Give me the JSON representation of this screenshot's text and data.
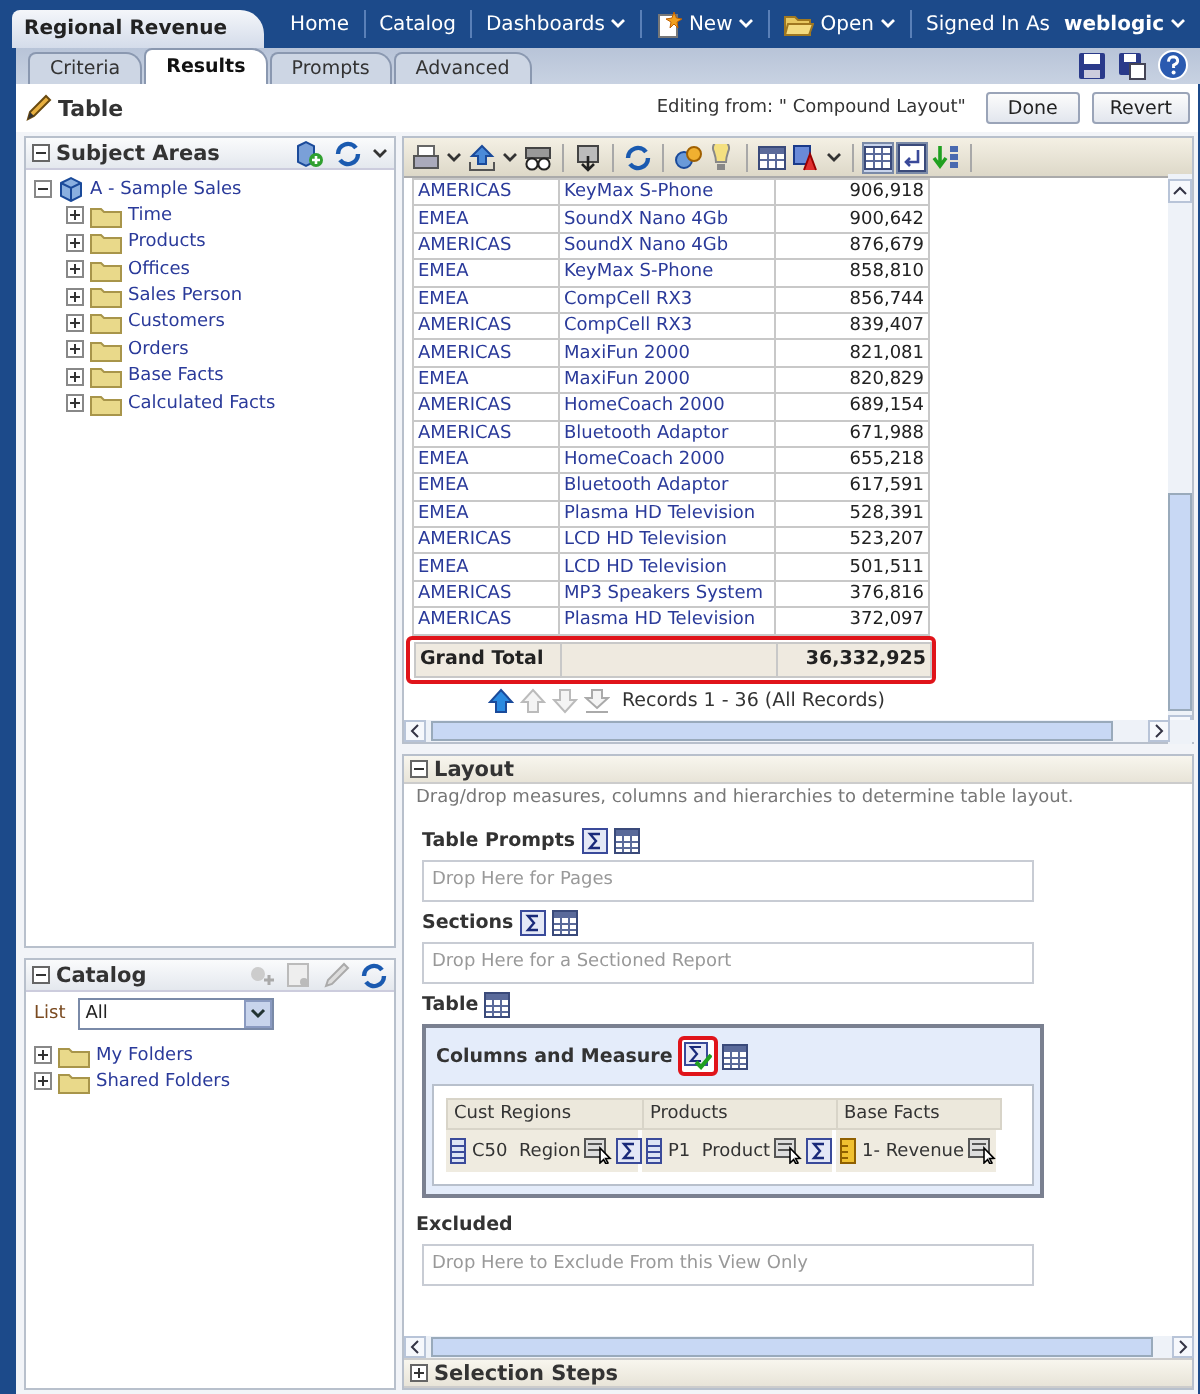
{
  "window": {
    "title": "Regional Revenue"
  },
  "nav": [
    {
      "label": "Home",
      "kind": "plain",
      "dropdown": false
    },
    {
      "label": "Catalog",
      "kind": "plain",
      "dropdown": false
    },
    {
      "label": "Dashboards",
      "kind": "plain",
      "dropdown": true
    },
    {
      "label": "New",
      "kind": "new",
      "dropdown": true
    },
    {
      "label": "Open",
      "kind": "open",
      "dropdown": true
    }
  ],
  "user": {
    "label": "Signed In As",
    "name": "weblogic",
    "dropdown": true
  },
  "tabs": [
    {
      "label": "Criteria",
      "selected": false
    },
    {
      "label": "Results",
      "selected": true
    },
    {
      "label": "Prompts",
      "selected": false
    },
    {
      "label": "Advanced",
      "selected": false
    }
  ],
  "editor": {
    "title": "Table",
    "editing": "Editing from: \" Compound Layout\"",
    "buttons": [
      "Done",
      "Revert"
    ]
  },
  "subject_areas": {
    "title": "Subject Areas",
    "root": {
      "label": "A - Sample Sales",
      "expanded": true,
      "children": [
        {
          "label": "Time",
          "expanded": false
        },
        {
          "label": "Products",
          "expanded": false
        },
        {
          "label": "Offices",
          "expanded": false
        },
        {
          "label": "Sales Person",
          "expanded": false
        },
        {
          "label": "Customers",
          "expanded": false
        },
        {
          "label": "Orders",
          "expanded": false
        },
        {
          "label": "Base Facts",
          "expanded": false
        },
        {
          "label": "Calculated Facts",
          "expanded": false
        }
      ]
    }
  },
  "catalog": {
    "title": "Catalog",
    "list_label": "List",
    "list_value": "All",
    "folders": [
      {
        "label": "My Folders",
        "expanded": false
      },
      {
        "label": "Shared Folders",
        "expanded": false
      }
    ]
  },
  "results": {
    "rows": [
      [
        "AMERICAS",
        "KeyMax S-Phone",
        "906,918"
      ],
      [
        "EMEA",
        "SoundX Nano 4Gb",
        "900,642"
      ],
      [
        "AMERICAS",
        "SoundX Nano 4Gb",
        "876,679"
      ],
      [
        "EMEA",
        "KeyMax S-Phone",
        "858,810"
      ],
      [
        "EMEA",
        "CompCell RX3",
        "856,744"
      ],
      [
        "AMERICAS",
        "CompCell RX3",
        "839,407"
      ],
      [
        "AMERICAS",
        "MaxiFun 2000",
        "821,081"
      ],
      [
        "EMEA",
        "MaxiFun 2000",
        "820,829"
      ],
      [
        "AMERICAS",
        "HomeCoach 2000",
        "689,154"
      ],
      [
        "AMERICAS",
        "Bluetooth Adaptor",
        "671,988"
      ],
      [
        "EMEA",
        "HomeCoach 2000",
        "655,218"
      ],
      [
        "EMEA",
        "Bluetooth Adaptor",
        "617,591"
      ],
      [
        "EMEA",
        "Plasma HD Television",
        "528,391"
      ],
      [
        "AMERICAS",
        "LCD HD Television",
        "523,207"
      ],
      [
        "EMEA",
        "LCD HD Television",
        "501,511"
      ],
      [
        "AMERICAS",
        "MP3 Speakers System",
        "376,816"
      ],
      [
        "AMERICAS",
        "Plasma HD Television",
        "372,097"
      ]
    ],
    "grand_total": {
      "label": "Grand Total",
      "value": "36,332,925"
    },
    "records": "Records 1 - 36 (All Records)"
  },
  "layout": {
    "title": "Layout",
    "expanded": true,
    "hint": "Drag/drop measures, columns and hierarchies to determine table layout.",
    "drop_sections": [
      {
        "title": "Table Prompts",
        "placeholder": "Drop Here for Pages"
      },
      {
        "title": "Sections",
        "placeholder": "Drop Here for a Sectioned Report"
      }
    ],
    "table_title": "Table",
    "columns_title": "Columns and Measure",
    "columns": [
      {
        "header": "Cust Regions",
        "item": "C50  Region",
        "kind": "attribute",
        "totals": true
      },
      {
        "header": "Products",
        "item": "P1  Product",
        "kind": "attribute",
        "totals": true
      },
      {
        "header": "Base Facts",
        "item": "1- Revenue",
        "kind": "measure",
        "totals": false
      }
    ],
    "excluded": {
      "title": "Excluded",
      "placeholder": "Drop Here to Exclude From this View Only"
    }
  },
  "selection_steps": {
    "title": "Selection Steps",
    "expanded": false
  }
}
